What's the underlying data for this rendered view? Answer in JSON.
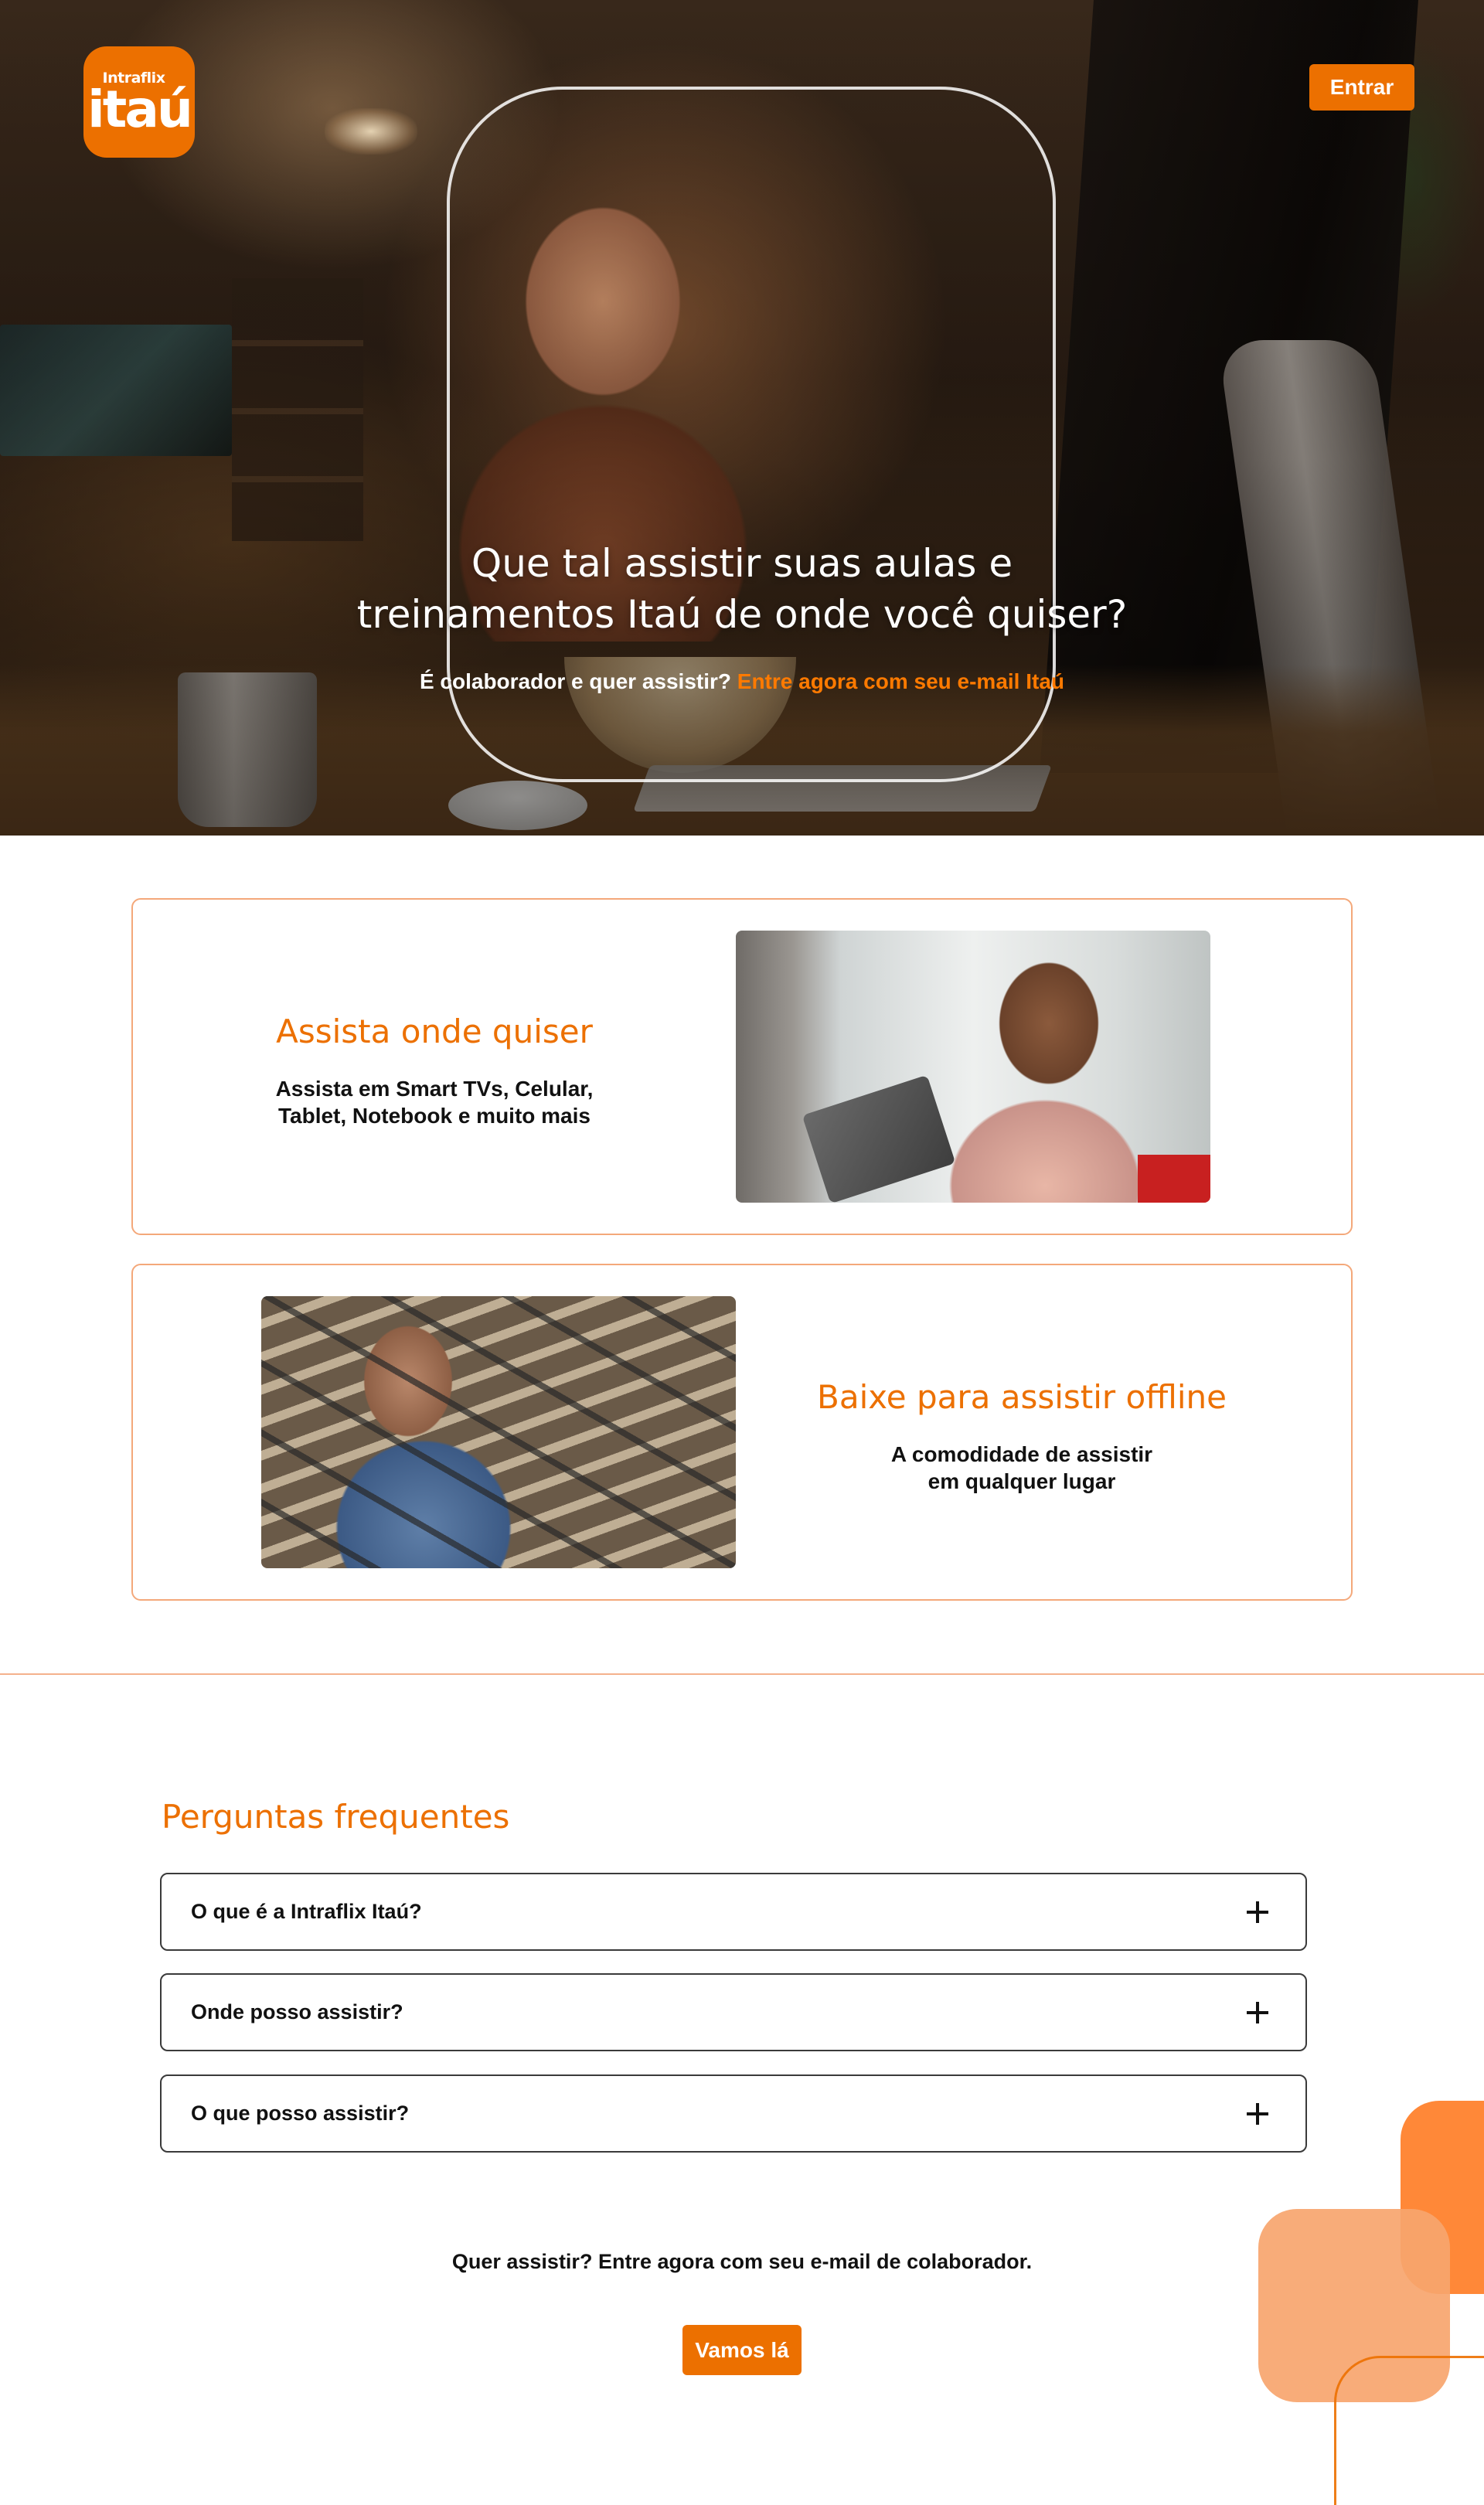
{
  "brand": {
    "logo_small": "Intraflix",
    "logo_big": "itaú",
    "accent_color": "#ec7000"
  },
  "header": {
    "enter_label": "Entrar"
  },
  "hero": {
    "title_line1": "Que tal assistir suas aulas e",
    "title_line2": "treinamentos Itaú de onde você quiser?",
    "subtitle_prefix": "É colaborador e quer assistir?",
    "subtitle_link": "Entre agora com seu e-mail Itaú"
  },
  "features": [
    {
      "title": "Assista onde quiser",
      "desc_line1": "Assista em Smart TVs, Celular,",
      "desc_line2": "Tablet, Notebook e muito mais"
    },
    {
      "title": "Baixe para assistir offline",
      "desc_line1": "A comodidade de assistir",
      "desc_line2": "em qualquer lugar"
    }
  ],
  "faq": {
    "title": "Perguntas frequentes",
    "items": [
      {
        "question": "O que é a Intraflix Itaú?",
        "icon": "plus-icon"
      },
      {
        "question": "Onde posso assistir?",
        "icon": "plus-icon"
      },
      {
        "question": "O que posso assistir?",
        "icon": "plus-icon"
      }
    ]
  },
  "cta": {
    "text": "Quer assistir? Entre agora com seu e-mail de colaborador.",
    "button_label": "Vamos lá"
  }
}
